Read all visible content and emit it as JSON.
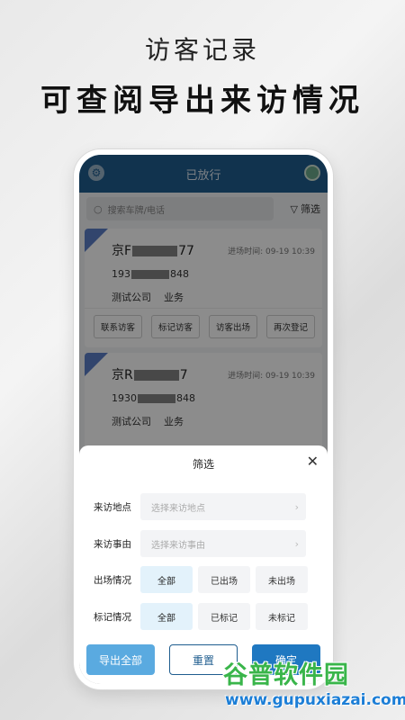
{
  "promo": {
    "subtitle": "访客记录",
    "title": "可查阅导出来访情况"
  },
  "app": {
    "title": "已放行",
    "settings_icon": "gear-icon",
    "avatar_icon": "avatar-icon"
  },
  "search": {
    "placeholder": "搜索车牌/电话",
    "filter_label": "筛选"
  },
  "records": [
    {
      "plate_prefix": "京F",
      "plate_suffix": "77",
      "time": "进场时间: 09-19 10:39",
      "phone_prefix": "193",
      "phone_suffix": "848",
      "company": "测试公司",
      "purpose": "业务",
      "actions": [
        "联系访客",
        "标记访客",
        "访客出场",
        "再次登记"
      ]
    },
    {
      "plate_prefix": "京R",
      "plate_suffix": "7",
      "time": "进场时间: 09-19 10:39",
      "phone_prefix": "1930",
      "phone_suffix": "848",
      "company": "测试公司",
      "purpose": "业务"
    }
  ],
  "filter_sheet": {
    "title": "筛选",
    "location_label": "来访地点",
    "location_placeholder": "选择来访地点",
    "reason_label": "来访事由",
    "reason_placeholder": "选择来访事由",
    "exit_label": "出场情况",
    "exit_options": [
      "全部",
      "已出场",
      "未出场"
    ],
    "exit_selected": "全部",
    "mark_label": "标记情况",
    "mark_options": [
      "全部",
      "已标记",
      "未标记"
    ],
    "mark_selected": "全部",
    "export_button": "导出全部",
    "reset_button": "重置",
    "confirm_button": "确定"
  },
  "watermark": {
    "name": "谷普软件园",
    "url": "www.gupuxiazai.com"
  },
  "colors": {
    "primary": "#1f5d8f",
    "accent": "#1f78c1",
    "export": "#5aaae0",
    "chip_active": "#e3f2fb",
    "watermark_green": "#39b54a",
    "watermark_blue": "#1c7ed6"
  }
}
